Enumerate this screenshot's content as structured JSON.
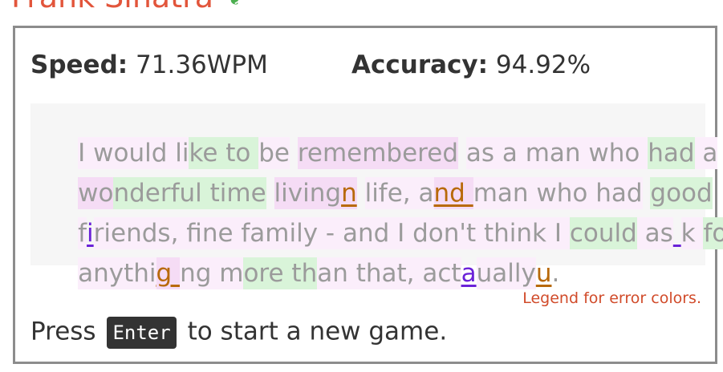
{
  "quote": {
    "author": "Frank Sinatra"
  },
  "stats": {
    "speed_label": "Speed:",
    "speed_value": "71.36WPM",
    "accuracy_label": "Accuracy:",
    "accuracy_value": "94.92%"
  },
  "typed_text": {
    "lines": [
      "I would like to be remembered as a man who had a",
      "wonderful time livingn life, and man who had good",
      "fiiriends, fine family - and I don't think I could as k for",
      "anythig ng more than that, actaually u."
    ]
  },
  "legend_link": "Legend for error colors.",
  "footer": {
    "press": "Press",
    "key": "Enter",
    "rest": "to start a new game."
  },
  "colors": {
    "author": "#e2553b",
    "correct_bg": "#d9f4d9",
    "slow_bg": "#f5dcf5",
    "error_orange": "#b8690a",
    "error_purple": "#6b21d8",
    "legend": "#d14b2a"
  }
}
